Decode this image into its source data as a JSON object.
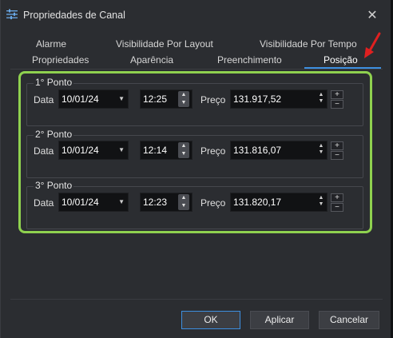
{
  "window": {
    "title": "Propriedades de Canal"
  },
  "tabs_row1": [
    "Alarme",
    "Visibilidade Por Layout",
    "Visibilidade Por Tempo"
  ],
  "tabs_row2": [
    "Propriedades",
    "Aparência",
    "Preenchimento",
    "Posição"
  ],
  "active_tab": "Posição",
  "labels": {
    "date": "Data",
    "price": "Preço",
    "plus": "+",
    "minus": "−"
  },
  "points": [
    {
      "title": "1° Ponto",
      "date": "10/01/24",
      "time": "12:25",
      "price": "131.917,52"
    },
    {
      "title": "2° Ponto",
      "date": "10/01/24",
      "time": "12:14",
      "price": "131.816,07"
    },
    {
      "title": "3° Ponto",
      "date": "10/01/24",
      "time": "12:23",
      "price": "131.820,17"
    }
  ],
  "buttons": {
    "ok": "OK",
    "apply": "Aplicar",
    "cancel": "Cancelar"
  },
  "icons": {
    "title": "settings-sliders-icon",
    "close": "close-icon",
    "dropdown": "chevron-down-icon",
    "annotation": "red-arrow-icon"
  },
  "colors": {
    "accent": "#3d8fe0",
    "highlight": "#8fd14f",
    "annotation": "#e02020"
  }
}
